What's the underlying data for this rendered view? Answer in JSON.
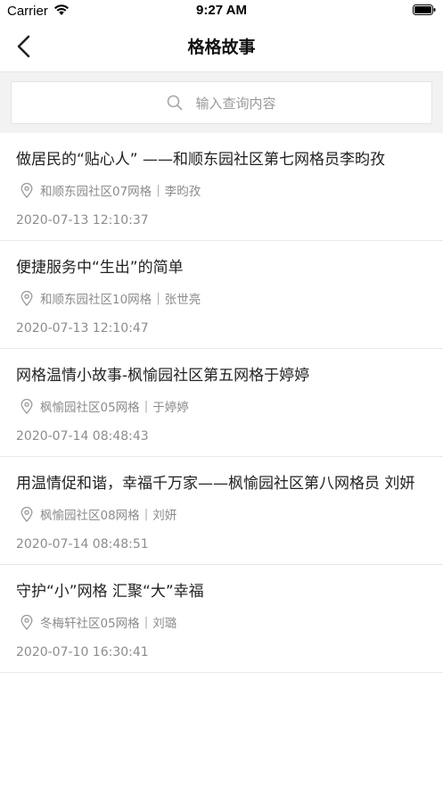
{
  "status": {
    "carrier": "Carrier",
    "time": "9:27 AM"
  },
  "nav": {
    "title": "格格故事"
  },
  "search": {
    "placeholder": "输入查询内容"
  },
  "stories": [
    {
      "title": "做居民的“贴心人” ——和顺东园社区第七网格员李昀孜",
      "grid": "和顺东园社区07网格",
      "author": "李昀孜",
      "date": "2020-07-13 12:10:37"
    },
    {
      "title": "便捷服务中“生出”的简单",
      "grid": "和顺东园社区10网格",
      "author": "张世亮",
      "date": "2020-07-13 12:10:47"
    },
    {
      "title": "网格温情小故事-枫愉园社区第五网格于婷婷",
      "grid": "枫愉园社区05网格",
      "author": "于婷婷",
      "date": "2020-07-14 08:48:43"
    },
    {
      "title": "用温情促和谐，幸福千万家——枫愉园社区第八网格员 刘妍",
      "grid": "枫愉园社区08网格",
      "author": "刘妍",
      "date": "2020-07-14 08:48:51"
    },
    {
      "title": "守护“小”网格 汇聚“大”幸福",
      "grid": "冬梅轩社区05网格",
      "author": "刘璐",
      "date": "2020-07-10 16:30:41"
    }
  ],
  "icons": {
    "back": "chevron-left-icon",
    "search": "search-icon",
    "location": "location-pin-icon"
  }
}
